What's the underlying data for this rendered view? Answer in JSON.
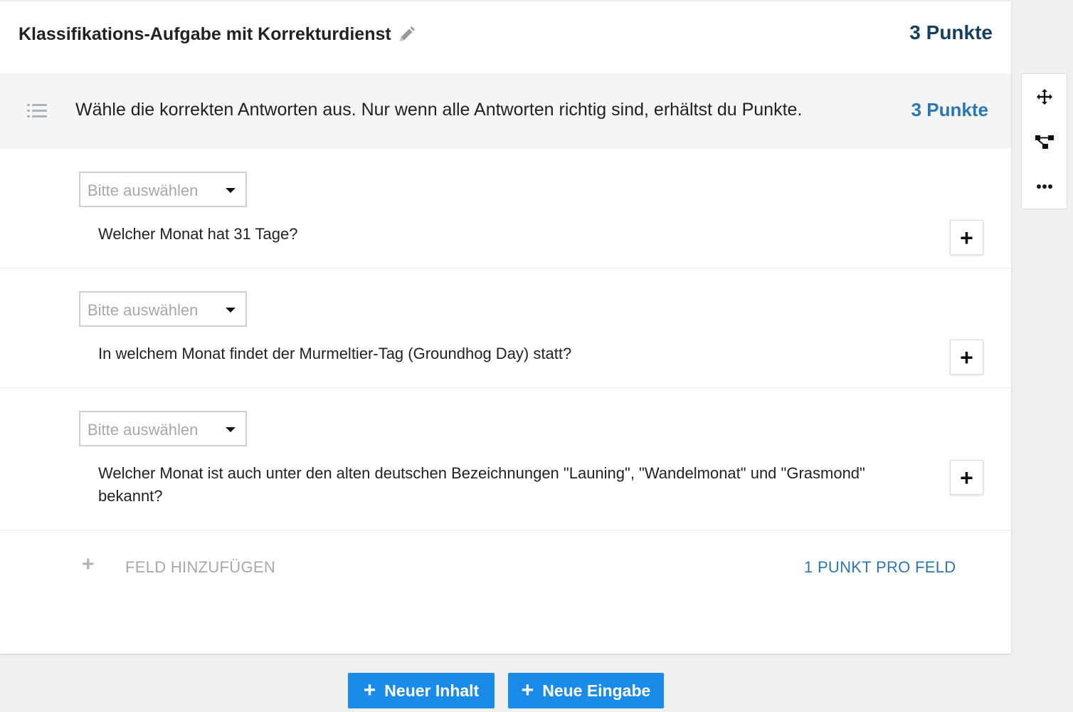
{
  "header": {
    "title": "Klassifikations-Aufgabe mit Korrekturdienst",
    "points": "3 Punkte"
  },
  "instruction": {
    "text": "Wähle die korrekten Antworten aus. Nur wenn alle Antworten richtig sind, erhältst du Punkte.",
    "points": "3 Punkte"
  },
  "rows": [
    {
      "select_placeholder": "Bitte auswählen",
      "question": "Welcher Monat hat 31 Tage?"
    },
    {
      "select_placeholder": "Bitte auswählen",
      "question": "In welchem Monat findet der Murmeltier-Tag (Groundhog Day) statt?"
    },
    {
      "select_placeholder": "Bitte auswählen",
      "question": "Welcher Monat ist auch unter den alten deutschen Bezeichnungen \"Launing\", \"Wandelmonat\" und \"Grasmond\" bekannt?"
    }
  ],
  "add_field": {
    "label": "FELD HINZUFÜGEN",
    "per_field": "1 PUNKT PRO FELD"
  },
  "toolbar": {
    "icons": [
      "move-icon",
      "hierarchy-icon",
      "more-icon"
    ]
  },
  "buttons": {
    "new_content": "Neuer Inhalt",
    "new_input": "Neue Eingabe"
  },
  "colors": {
    "primary_button": "#1a8be8",
    "points_dark": "#173f5f",
    "points_blue": "#2a77b2"
  }
}
